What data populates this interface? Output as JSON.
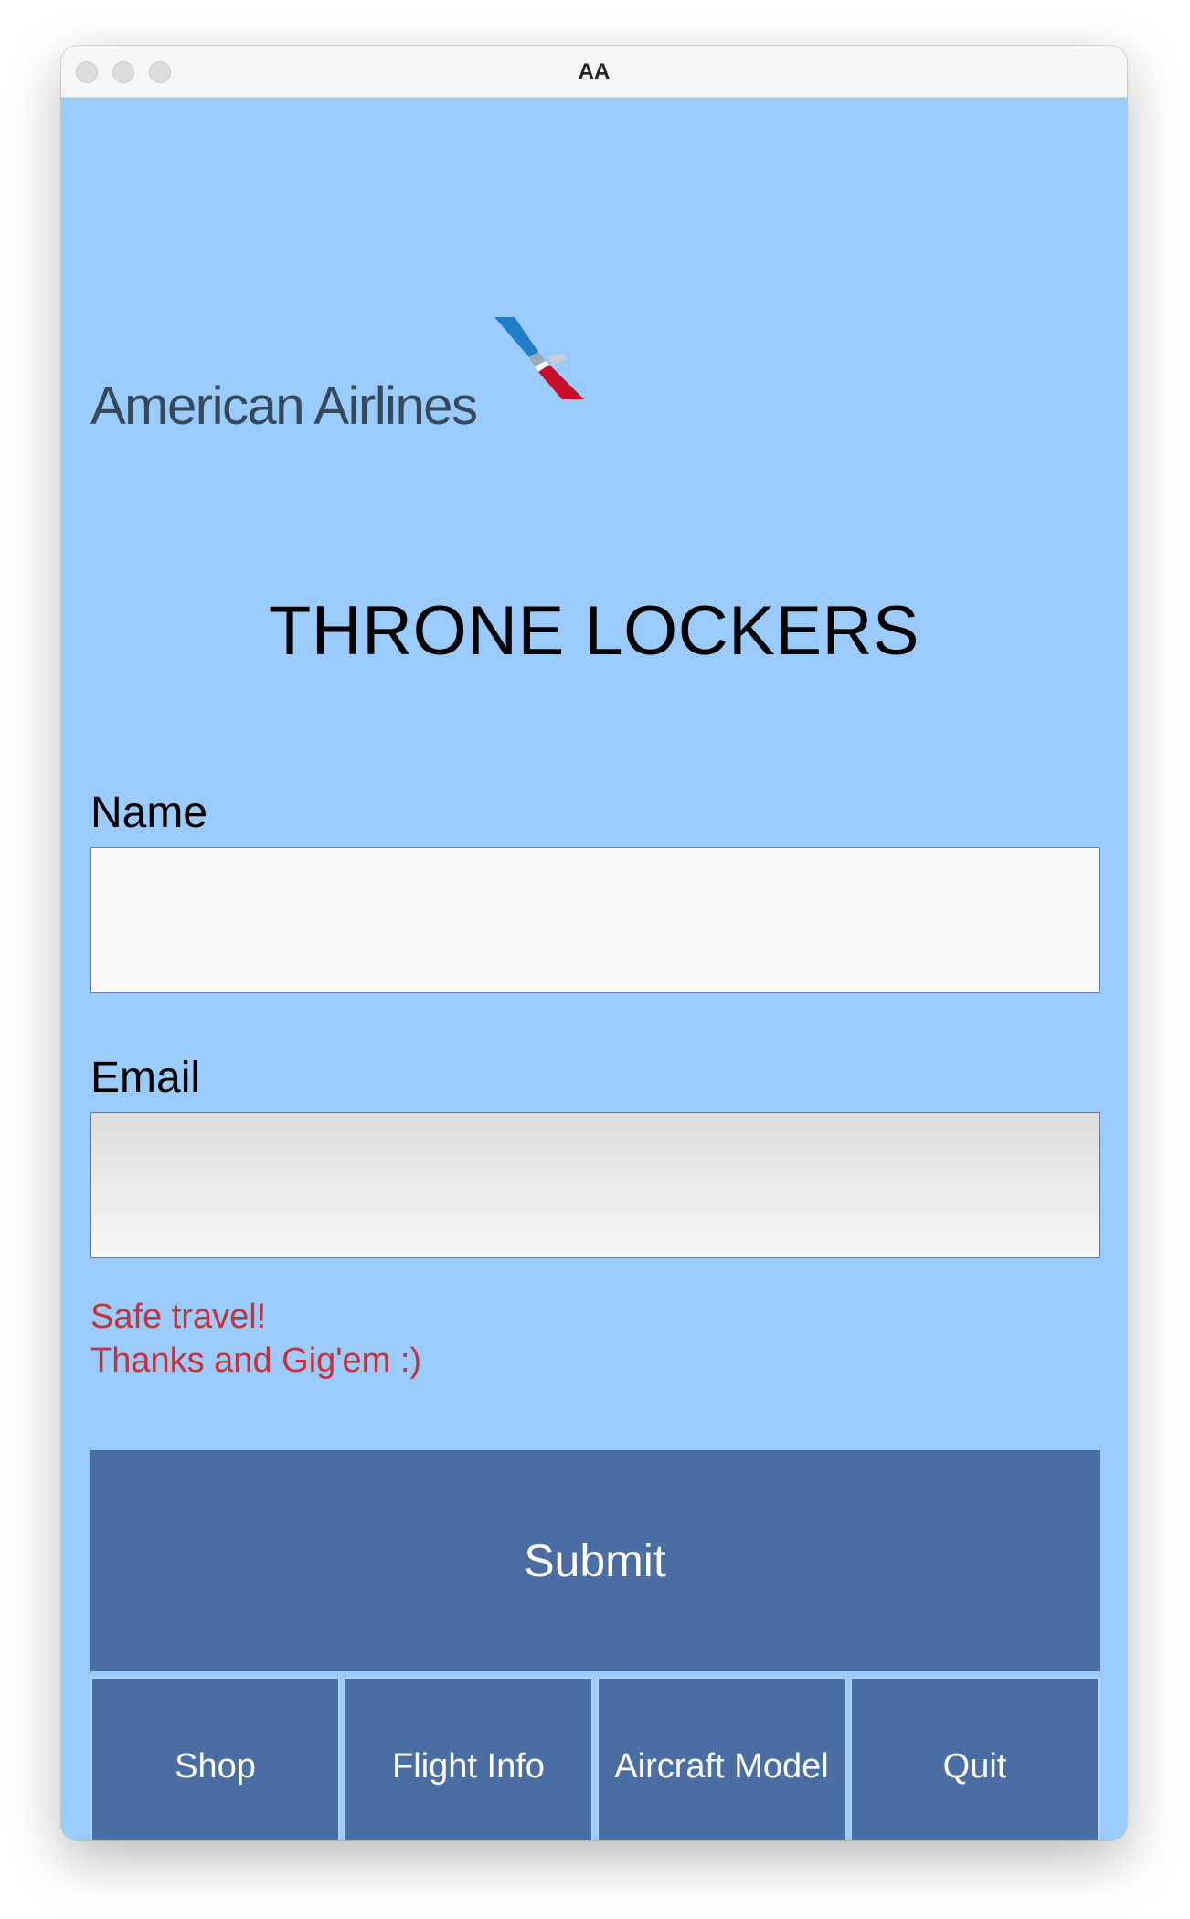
{
  "window": {
    "title": "AA"
  },
  "logo": {
    "text": "American Airlines"
  },
  "app": {
    "title": "THRONE LOCKERS"
  },
  "form": {
    "name_label": "Name",
    "name_value": "",
    "email_label": "Email",
    "email_value": ""
  },
  "message": {
    "line1": "Safe travel!",
    "line2": "Thanks and Gig'em :)",
    "color": "#C9313A"
  },
  "actions": {
    "submit_label": "Submit",
    "nav": [
      {
        "label": "Shop"
      },
      {
        "label": "Flight Info"
      },
      {
        "label": "Aircraft Model"
      },
      {
        "label": "Quit"
      }
    ]
  },
  "colors": {
    "background": "#9ACBFA",
    "button": "#4A6EA4",
    "button_text": "#FFFFFF"
  }
}
